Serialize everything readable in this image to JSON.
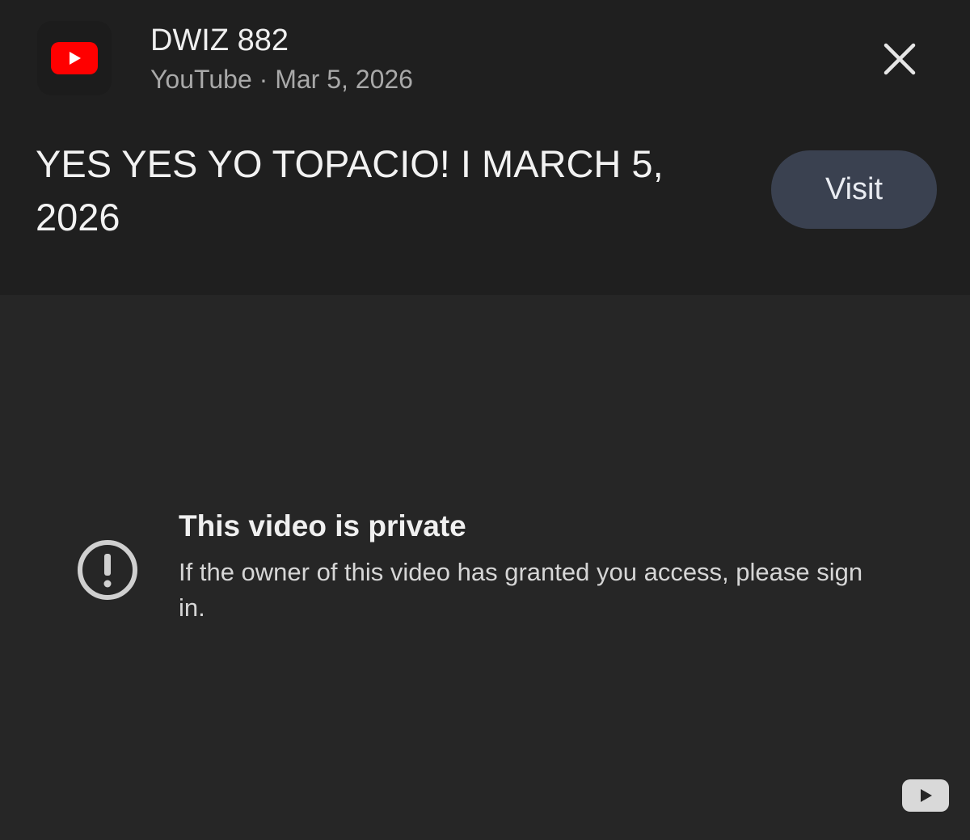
{
  "header": {
    "channel_name": "DWIZ 882",
    "source": "YouTube",
    "separator": "·",
    "date": "Mar 5, 2026",
    "video_title": "YES YES YO TOPACIO! I MARCH 5, 2026",
    "visit_label": "Visit",
    "close_icon": "close-icon",
    "logo_icon": "youtube-logo-icon"
  },
  "player": {
    "status_title": "This video is private",
    "status_message": "If the owner of this video has granted you access, please sign in.",
    "status_icon": "exclamation-circle-icon",
    "corner_icon": "youtube-icon"
  },
  "colors": {
    "header_bg": "#1f1f1f",
    "player_bg": "#262626",
    "visit_button_bg": "#3a4150",
    "youtube_red": "#ff0000"
  }
}
